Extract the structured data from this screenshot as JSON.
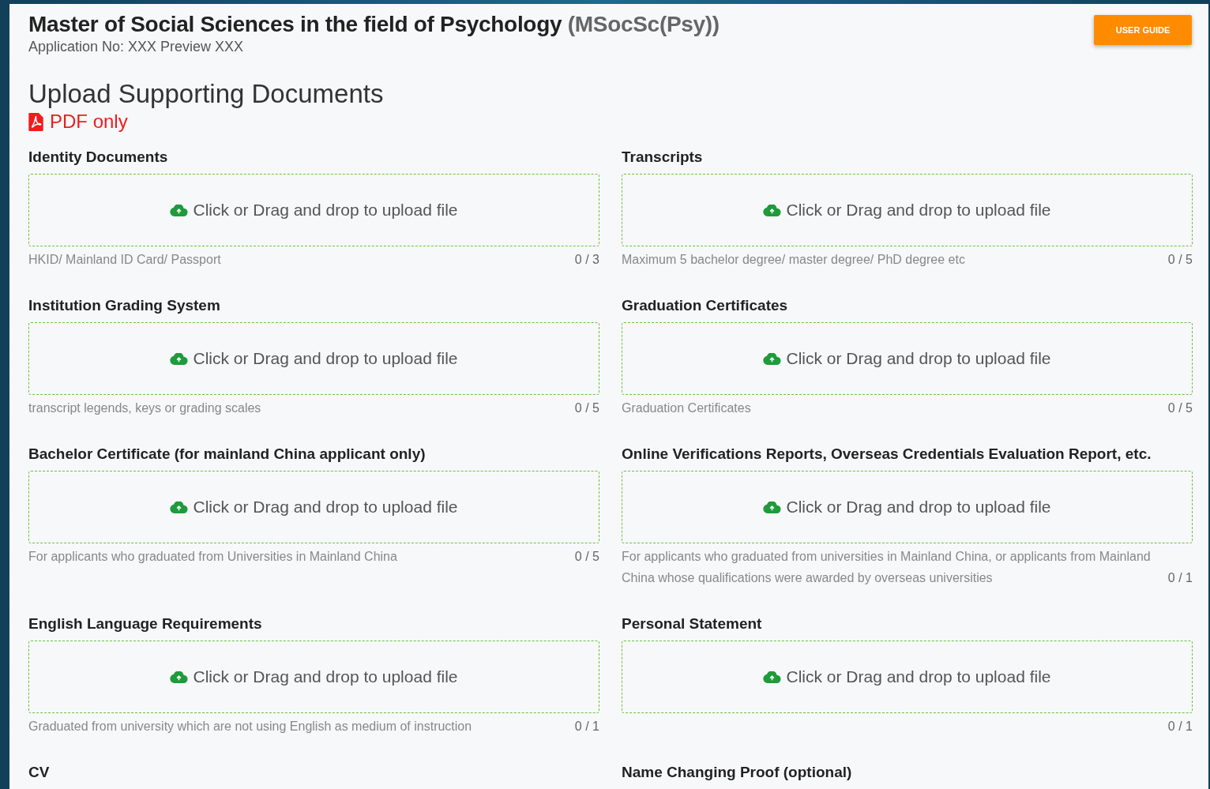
{
  "header": {
    "title": "Master of Social Sciences in the field of Psychology",
    "abbreviation": "(MSocSc(Psy))",
    "application_no": "Application No: XXX Preview XXX",
    "user_guide_button": "USER GUIDE"
  },
  "section": {
    "title": "Upload Supporting Documents",
    "format_note": "PDF only"
  },
  "fields": [
    {
      "label": "Identity Documents",
      "prompt": "Click or Drag and drop to upload file",
      "note": "HKID/ Mainland ID Card/ Passport",
      "count": "0 / 3"
    },
    {
      "label": "Transcripts",
      "prompt": "Click or Drag and drop to upload file",
      "note": "Maximum 5 bachelor degree/ master degree/ PhD degree etc",
      "count": "0 / 5"
    },
    {
      "label": "Institution Grading System",
      "prompt": "Click or Drag and drop to upload file",
      "note": "transcript legends, keys or grading scales",
      "count": "0 / 5"
    },
    {
      "label": "Graduation Certificates",
      "prompt": "Click or Drag and drop to upload file",
      "note": "Graduation Certificates",
      "count": "0 / 5"
    },
    {
      "label": "Bachelor Certificate (for mainland China applicant only)",
      "prompt": "Click or Drag and drop to upload file",
      "note": "For applicants who graduated from Universities in Mainland China",
      "count": "0 / 5"
    },
    {
      "label": "Online Verifications Reports, Overseas Credentials Evaluation Report, etc.",
      "prompt": "Click or Drag and drop to upload file",
      "note": "For applicants who graduated from universities in Mainland China, or applicants from Mainland China whose qualifications were awarded by overseas universities",
      "count": "0 / 1"
    },
    {
      "label": "English Language Requirements",
      "prompt": "Click or Drag and drop to upload file",
      "note": "Graduated from university which are not using English as medium of instruction",
      "count": "0 / 1"
    },
    {
      "label": "Personal Statement",
      "prompt": "Click or Drag and drop to upload file",
      "count": "0 / 1"
    },
    {
      "label": "CV"
    },
    {
      "label": "Name Changing Proof (optional)"
    }
  ]
}
